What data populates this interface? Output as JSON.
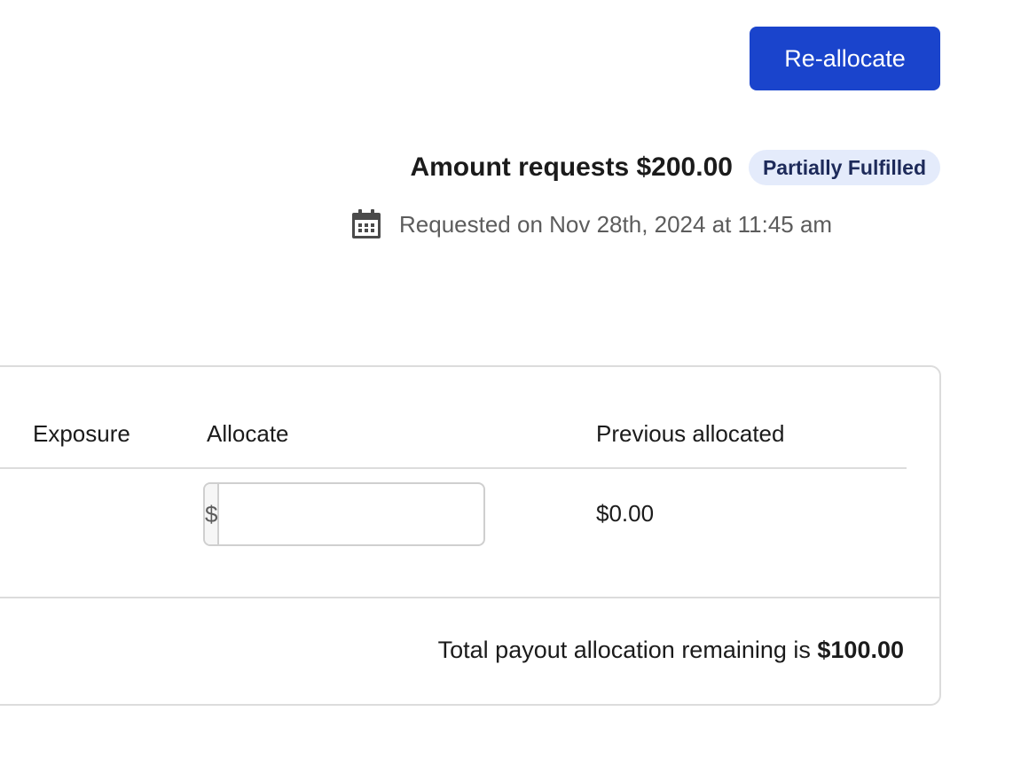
{
  "header": {
    "reallocate_label": "Re-allocate"
  },
  "request": {
    "title": "Amount requests $200.00",
    "status": "Partially Fulfilled",
    "requested_on": "Requested on Nov 28th, 2024 at 11:45 am",
    "icon": "calendar-icon"
  },
  "table": {
    "columns": [
      "Exposure",
      "Allocate",
      "Previous allocated"
    ],
    "rows": [
      {
        "exposure": "",
        "allocate_prefix": "$",
        "allocate_value": "",
        "previous_allocated": "$0.00"
      }
    ],
    "footer": {
      "text": "Total payout allocation remaining is ",
      "amount": "$100.00"
    }
  },
  "colors": {
    "accent": "#1a44cc",
    "badge_bg": "#e4ebfb",
    "badge_text": "#1d2a5a",
    "muted_text": "#5c5c5c",
    "border": "#dcdcdc"
  }
}
